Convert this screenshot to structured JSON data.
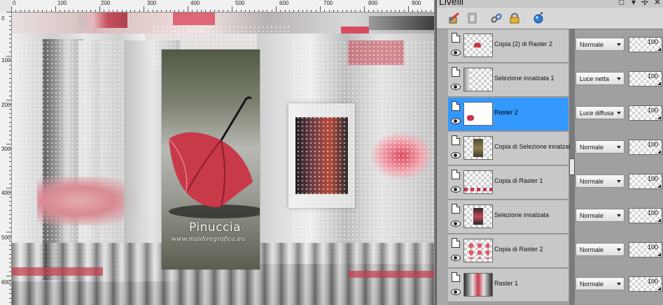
{
  "rulers": {
    "horizontal_labels": [
      "0",
      "100",
      "200",
      "300",
      "400",
      "500",
      "600",
      "700",
      "800",
      "900"
    ],
    "vertical_labels": [
      "0",
      "100",
      "200",
      "300",
      "400",
      "500",
      "600"
    ]
  },
  "artwork": {
    "watermark_title": "Pinuccia",
    "watermark_url": "www.maidiregrafica.eu"
  },
  "layers_panel": {
    "title": "Livelli",
    "toolbar_icons": [
      "paint-brush-icon",
      "mask-icon",
      "link-icon",
      "lock-icon",
      "layer-style-icon"
    ],
    "layers": [
      {
        "name": "Copia (2) di Raster 2",
        "blend_mode": "Normale",
        "opacity": "100",
        "visible": true,
        "selected": false
      },
      {
        "name": "Selezione innalzata 1",
        "blend_mode": "Luce netta",
        "opacity": "100",
        "visible": true,
        "selected": false
      },
      {
        "name": "Raster 2",
        "blend_mode": "Luce diffusa",
        "opacity": "100",
        "visible": true,
        "selected": true
      },
      {
        "name": "Copia di Selezione innalzata",
        "blend_mode": "Normale",
        "opacity": "100",
        "visible": true,
        "selected": false
      },
      {
        "name": "Copia di Raster 1",
        "blend_mode": "Normale",
        "opacity": "100",
        "visible": true,
        "selected": false
      },
      {
        "name": "Selezione innalzata",
        "blend_mode": "Normale",
        "opacity": "100",
        "visible": true,
        "selected": false
      },
      {
        "name": "Copia di Raster 2",
        "blend_mode": "Normale",
        "opacity": "100",
        "visible": true,
        "selected": false
      },
      {
        "name": "Raster 1",
        "blend_mode": "Normale",
        "opacity": "100",
        "visible": true,
        "selected": false
      }
    ]
  },
  "colors": {
    "selection": "#3399ff",
    "accent_red": "#d8344a"
  }
}
